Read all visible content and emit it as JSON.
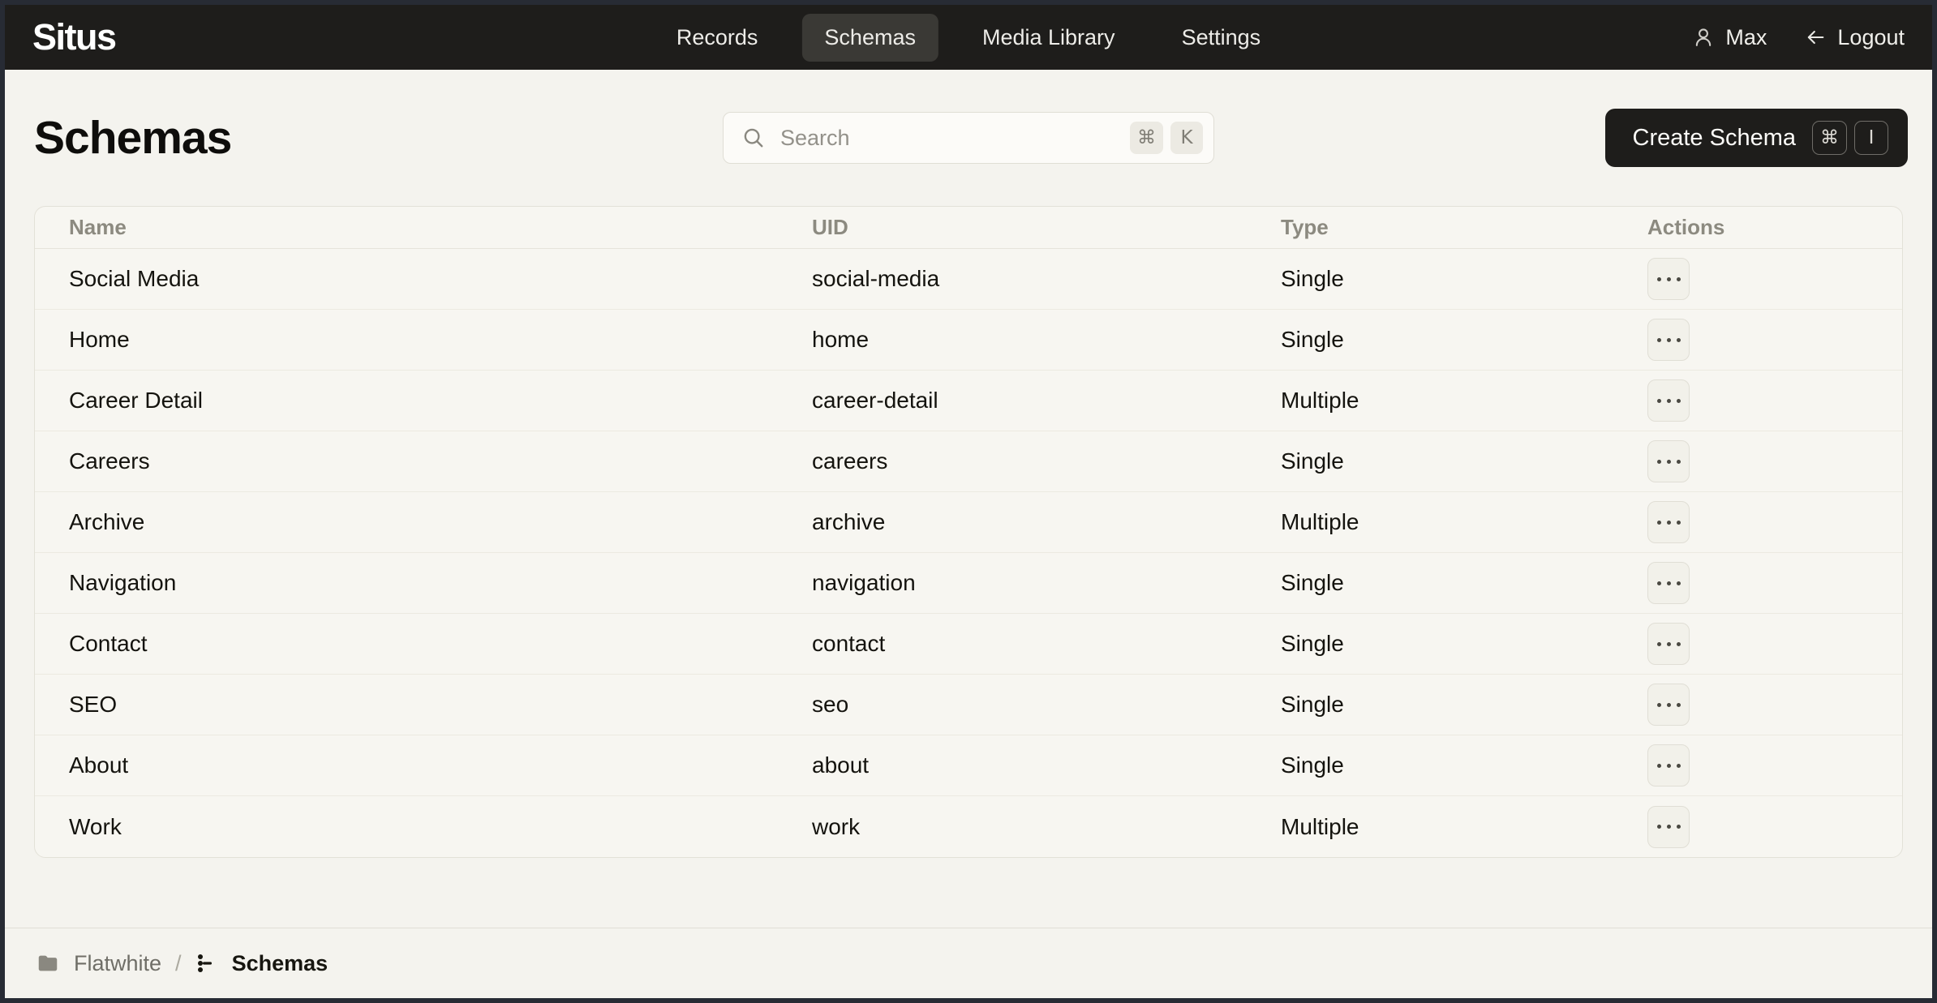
{
  "app": {
    "logo": "Situs"
  },
  "navbar": {
    "items": [
      {
        "label": "Records",
        "active": false
      },
      {
        "label": "Schemas",
        "active": true
      },
      {
        "label": "Media Library",
        "active": false
      },
      {
        "label": "Settings",
        "active": false
      }
    ],
    "user": {
      "name": "Max"
    },
    "logout": {
      "label": "Logout"
    }
  },
  "header": {
    "title": "Schemas",
    "search": {
      "placeholder": "Search",
      "shortcut_keys": [
        "⌘",
        "K"
      ]
    },
    "create_button": {
      "label": "Create Schema",
      "shortcut_keys": [
        "⌘",
        "I"
      ]
    }
  },
  "table": {
    "columns": [
      "Name",
      "UID",
      "Type",
      "Actions"
    ],
    "rows": [
      {
        "name": "Social Media",
        "uid": "social-media",
        "type": "Single"
      },
      {
        "name": "Home",
        "uid": "home",
        "type": "Single"
      },
      {
        "name": "Career Detail",
        "uid": "career-detail",
        "type": "Multiple"
      },
      {
        "name": "Careers",
        "uid": "careers",
        "type": "Single"
      },
      {
        "name": "Archive",
        "uid": "archive",
        "type": "Multiple"
      },
      {
        "name": "Navigation",
        "uid": "navigation",
        "type": "Single"
      },
      {
        "name": "Contact",
        "uid": "contact",
        "type": "Single"
      },
      {
        "name": "SEO",
        "uid": "seo",
        "type": "Single"
      },
      {
        "name": "About",
        "uid": "about",
        "type": "Single"
      },
      {
        "name": "Work",
        "uid": "work",
        "type": "Multiple"
      }
    ]
  },
  "footer": {
    "breadcrumb": [
      {
        "label": "Flatwhite",
        "icon": "folder-icon"
      },
      {
        "label": "Schemas",
        "icon": "schema-icon"
      }
    ],
    "separator": "/"
  },
  "colors": {
    "navbar_bg": "#1e1d1b",
    "page_bg": "#f4f3ee",
    "card_bg": "#f7f6f1",
    "accent_dark": "#1e1d1b",
    "border": "#e3e1d8",
    "muted_text": "#8c8a80",
    "frame_border": "#272b34"
  }
}
